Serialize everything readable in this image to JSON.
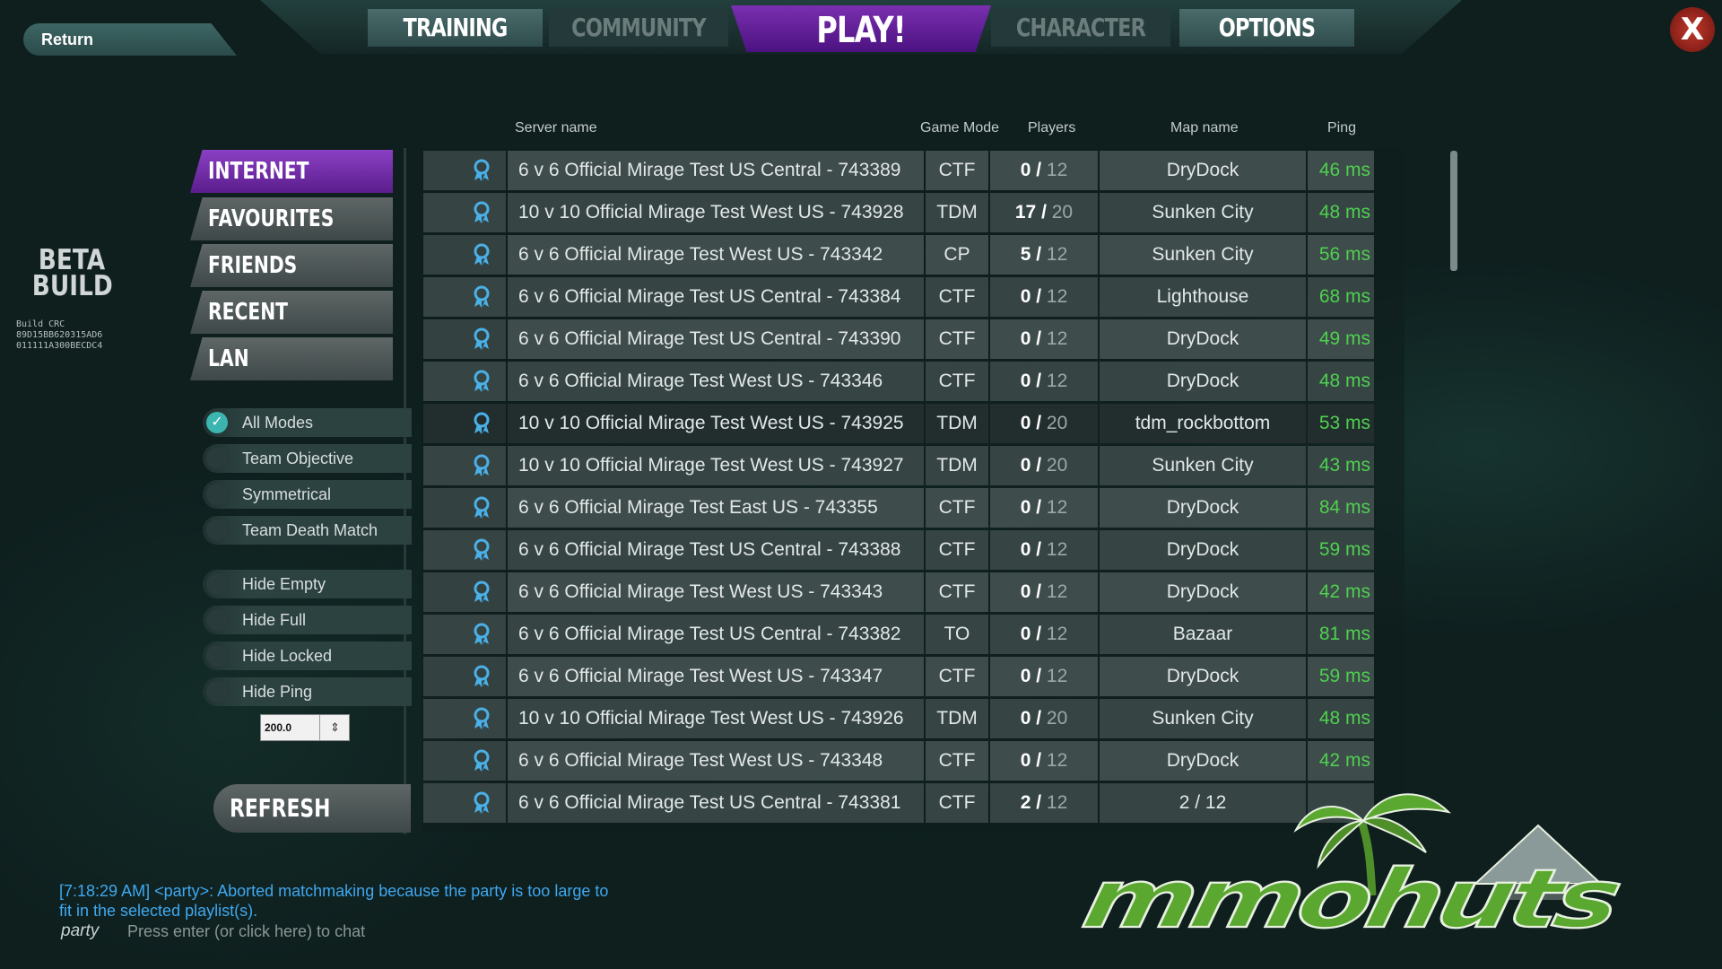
{
  "nav": {
    "return_label": "Return",
    "tabs": [
      {
        "label": "TRAINING"
      },
      {
        "label": "COMMUNITY"
      },
      {
        "label": "PLAY!"
      },
      {
        "label": "CHARACTER"
      },
      {
        "label": "OPTIONS"
      }
    ],
    "close_label": "X"
  },
  "build": {
    "beta_line1": "BETA",
    "beta_line2": "BUILD",
    "crc_label": "Build CRC",
    "crc_line1": "89D15BB620315AD6",
    "crc_line2": "011111A300BECDC4"
  },
  "categories": [
    {
      "label": "INTERNET",
      "active": true
    },
    {
      "label": "FAVOURITES",
      "active": false
    },
    {
      "label": "FRIENDS",
      "active": false
    },
    {
      "label": "RECENT",
      "active": false
    },
    {
      "label": "LAN",
      "active": false
    }
  ],
  "mode_filters": [
    {
      "label": "All Modes",
      "checked": true
    },
    {
      "label": "Team Objective",
      "checked": false
    },
    {
      "label": "Symmetrical",
      "checked": false
    },
    {
      "label": "Team Death Match",
      "checked": false
    }
  ],
  "hide_filters": [
    {
      "label": "Hide Empty",
      "checked": false
    },
    {
      "label": "Hide Full",
      "checked": false
    },
    {
      "label": "Hide Locked",
      "checked": false
    },
    {
      "label": "Hide Ping",
      "checked": false
    }
  ],
  "ping_threshold": "200.0",
  "refresh_label": "REFRESH",
  "table": {
    "headers": {
      "server": "Server name",
      "mode": "Game Mode",
      "players": "Players",
      "map": "Map name",
      "ping": "Ping"
    },
    "rows": [
      {
        "name": "6 v 6 Official Mirage Test US Central - 743389",
        "mode": "CTF",
        "cur": "0 /",
        "max": "12",
        "map": "DryDock",
        "ping": "46 ms"
      },
      {
        "name": "10 v 10 Official Mirage Test West US - 743928",
        "mode": "TDM",
        "cur": "17 /",
        "max": "20",
        "map": "Sunken City",
        "ping": "48 ms"
      },
      {
        "name": "6 v 6 Official Mirage Test West US - 743342",
        "mode": "CP",
        "cur": "5 /",
        "max": "12",
        "map": "Sunken City",
        "ping": "56 ms"
      },
      {
        "name": "6 v 6 Official Mirage Test US Central - 743384",
        "mode": "CTF",
        "cur": "0 /",
        "max": "12",
        "map": "Lighthouse",
        "ping": "68 ms"
      },
      {
        "name": "6 v 6 Official Mirage Test US Central - 743390",
        "mode": "CTF",
        "cur": "0 /",
        "max": "12",
        "map": "DryDock",
        "ping": "49 ms"
      },
      {
        "name": "6 v 6 Official Mirage Test West US - 743346",
        "mode": "CTF",
        "cur": "0 /",
        "max": "12",
        "map": "DryDock",
        "ping": "48 ms"
      },
      {
        "name": "10 v 10 Official Mirage Test West US - 743925",
        "mode": "TDM",
        "cur": "0 /",
        "max": "20",
        "map": "tdm_rockbottom",
        "ping": "53 ms"
      },
      {
        "name": "10 v 10 Official Mirage Test West US - 743927",
        "mode": "TDM",
        "cur": "0 /",
        "max": "20",
        "map": "Sunken City",
        "ping": "43 ms"
      },
      {
        "name": "6 v 6 Official Mirage Test East US - 743355",
        "mode": "CTF",
        "cur": "0 /",
        "max": "12",
        "map": "DryDock",
        "ping": "84 ms"
      },
      {
        "name": "6 v 6 Official Mirage Test US Central - 743388",
        "mode": "CTF",
        "cur": "0 /",
        "max": "12",
        "map": "DryDock",
        "ping": "59 ms"
      },
      {
        "name": "6 v 6 Official Mirage Test West US - 743343",
        "mode": "CTF",
        "cur": "0 /",
        "max": "12",
        "map": "DryDock",
        "ping": "42 ms"
      },
      {
        "name": "6 v 6 Official Mirage Test US Central - 743382",
        "mode": "TO",
        "cur": "0 /",
        "max": "12",
        "map": "Bazaar",
        "ping": "81 ms"
      },
      {
        "name": "6 v 6 Official Mirage Test West US - 743347",
        "mode": "CTF",
        "cur": "0 /",
        "max": "12",
        "map": "DryDock",
        "ping": "59 ms"
      },
      {
        "name": "10 v 10 Official Mirage Test West US - 743926",
        "mode": "TDM",
        "cur": "0 /",
        "max": "20",
        "map": "Sunken City",
        "ping": "48 ms"
      },
      {
        "name": "6 v 6 Official Mirage Test West US - 743348",
        "mode": "CTF",
        "cur": "0 /",
        "max": "12",
        "map": "DryDock",
        "ping": "42 ms"
      },
      {
        "name": "6 v 6 Official Mirage Test US Central - 743381",
        "mode": "CTF",
        "cur": "2 /",
        "max": "12",
        "map": "2 / 12",
        "ping": ""
      }
    ]
  },
  "chat": {
    "message": "[7:18:29 AM] <party>: Aborted matchmaking because the party is too large to fit in the selected playlist(s).",
    "channel": "party",
    "hint": "Press enter (or click here) to chat"
  },
  "watermark": "mmohuts",
  "colors": {
    "accent_purple": "#7a2fb0",
    "ping_green": "#4fd04f",
    "chat_blue": "#3fa8f0",
    "check_teal": "#3cb5b0"
  }
}
